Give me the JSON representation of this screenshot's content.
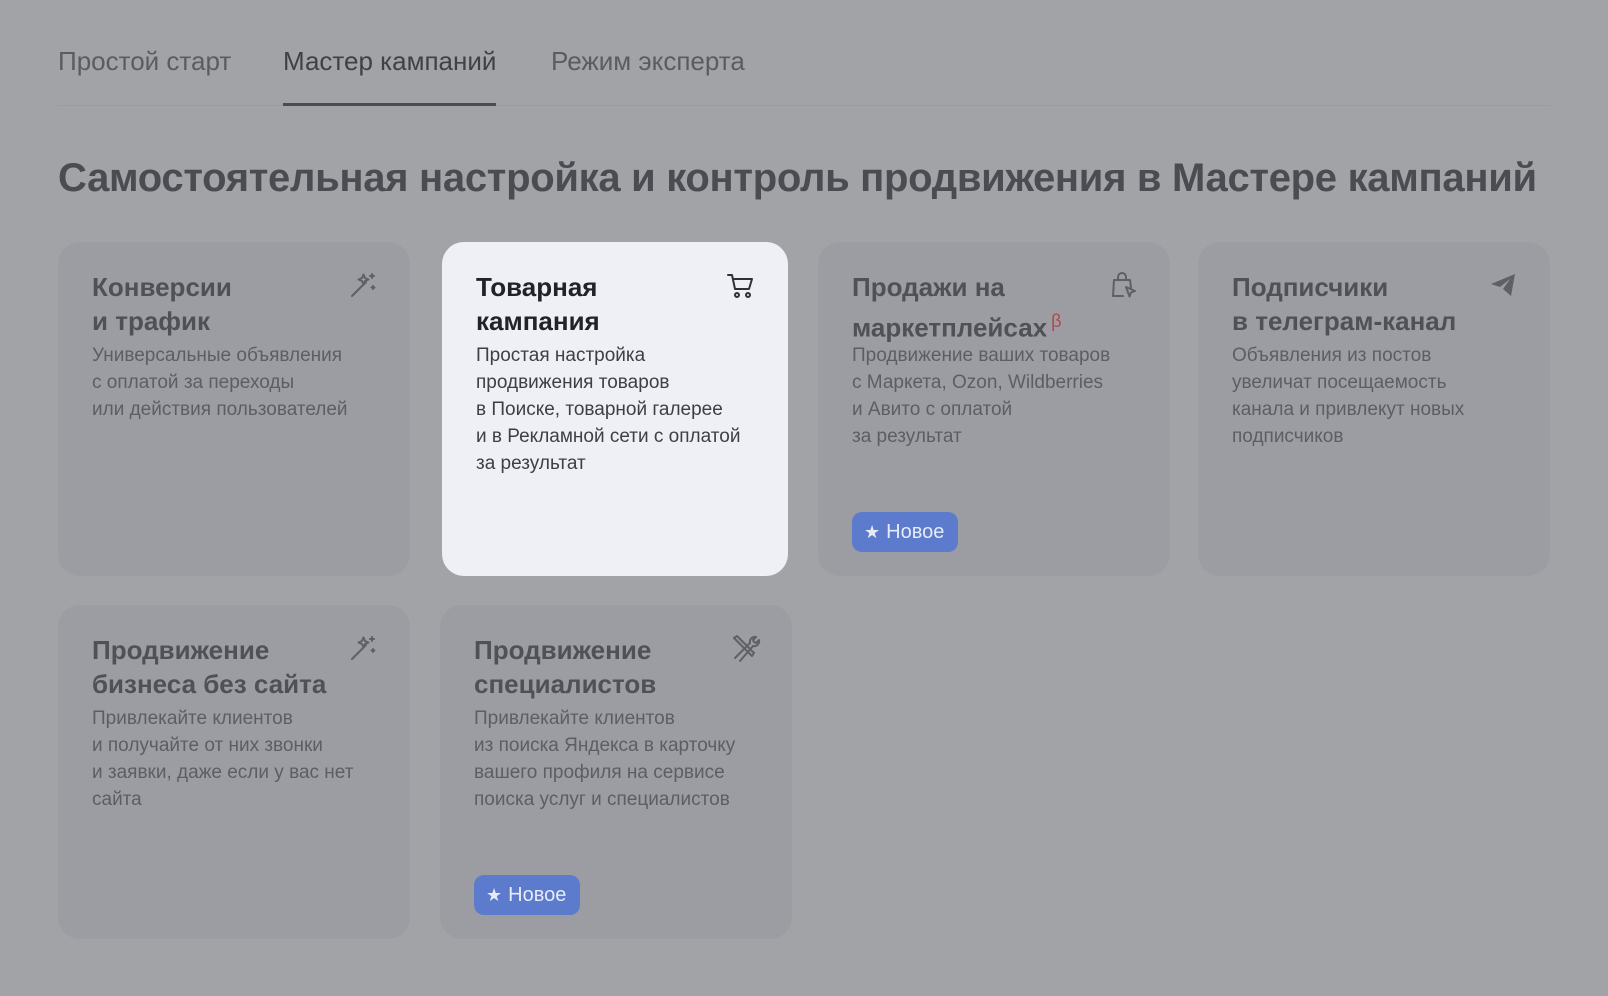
{
  "tabs": [
    {
      "label": "Простой старт",
      "active": false
    },
    {
      "label": "Мастер кампаний",
      "active": true
    },
    {
      "label": "Режим эксперта",
      "active": false
    }
  ],
  "heading": "Самостоятельная настройка и контроль продвижения в Мастере кампаний",
  "cards": [
    {
      "title_lines": [
        "Конверсии",
        "и трафик"
      ],
      "desc_lines": [
        "Универсальные объявления",
        "с оплатой за переходы",
        "или действия пользователей"
      ],
      "icon": "magic-wand-icon"
    },
    {
      "title_lines": [
        "Товарная",
        "кампания"
      ],
      "desc_lines": [
        "Простая настройка",
        "продвижения товаров",
        "в Поиске, товарной галерее",
        "и в Рекламной сети с оплатой",
        "за результат"
      ],
      "icon": "cart-icon",
      "selected": true
    },
    {
      "title_lines": [
        "Продажи на",
        "маркетплейсах"
      ],
      "title_suffix": "β",
      "desc_lines": [
        "Продвижение ваших товаров",
        "с Маркета, Ozon, Wildberries",
        "и Авито с оплатой",
        "за результат"
      ],
      "icon": "shopping-bag-cursor-icon",
      "badge": "Новое"
    },
    {
      "title_lines": [
        "Подписчики",
        "в телеграм-канал"
      ],
      "desc_lines": [
        "Объявления из постов",
        "увеличат посещаемость",
        "канала и привлекут новых",
        "подписчиков"
      ],
      "icon": "paper-plane-icon"
    },
    {
      "title_lines": [
        "Продвижение",
        "бизнеса без сайта"
      ],
      "desc_lines": [
        "Привлекайте клиентов",
        "и получайте от них звонки",
        "и заявки, даже если у вас нет",
        "сайта"
      ],
      "icon": "magic-wand-icon"
    },
    {
      "title_lines": [
        "Продвижение",
        "специалистов"
      ],
      "desc_lines": [
        "Привлекайте клиентов",
        "из поиска Яндекса в карточку",
        "вашего профиля на сервисе",
        "поиска услуг и специалистов"
      ],
      "icon": "tools-icon",
      "badge": "Новое"
    }
  ],
  "colors": {
    "overlay_bg": "#a1a3a7",
    "card_bg": "#9b9da2",
    "selected_card_bg": "#eef0f6",
    "badge_bg": "#5c7bcc",
    "beta": "#b14848"
  }
}
